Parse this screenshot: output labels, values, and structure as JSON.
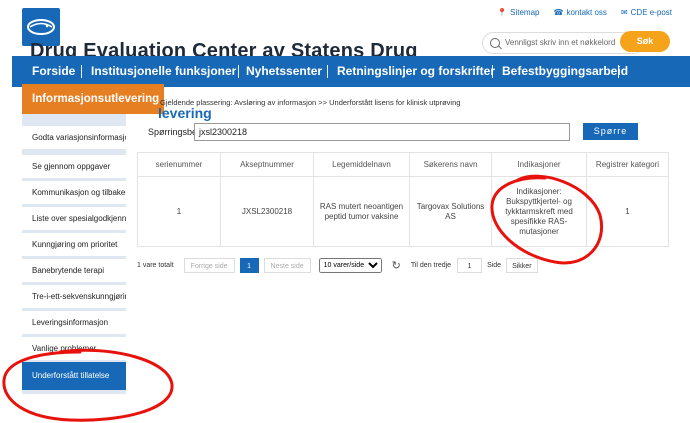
{
  "header": {
    "title": "Drug Evaluation Center av Statens Drug",
    "top_links": [
      {
        "icon": "location-pin-icon",
        "label": "Sitemap"
      },
      {
        "icon": "phone-icon",
        "label": "kontakt oss"
      },
      {
        "icon": "mail-icon",
        "label": "CDE e-post"
      }
    ],
    "search": {
      "placeholder": "Vennligst skriv inn et nøkkelord",
      "button_label": "Søk"
    },
    "accent_color": "#1769b8",
    "orange_color": "#f5a31a"
  },
  "nav": {
    "items": [
      "Forside",
      "Institusjonelle funksjoner",
      "Nyhetssenter",
      "Retningslinjer og forskrifter",
      "Befestbyggingsarbeid"
    ],
    "active_tab": "Informasjonsutlevering"
  },
  "sidebar": {
    "items": [
      "Godta variasjonsinformasjon",
      "Se gjennom oppgaver",
      "Kommunikasjon og tilbakemelding",
      "Liste over spesialgodkjenning",
      "Kunngjøring om prioritet",
      "Banebrytende terapi",
      "Tre-i-ett-sekvenskunngjøring",
      "Leveringsinformasjon",
      "Vanlige problemer",
      "Underforstått tillatelse"
    ],
    "active_index": 9
  },
  "main": {
    "breadcrumb": "Gjeldende plassering: Avsløring av informasjon >> Underforstått lisens for klinisk utprøving",
    "section_title": "levering",
    "query": {
      "label": "Spørringsbe",
      "value": "jxsl2300218",
      "button_label": "Spørre"
    },
    "table": {
      "headers": [
        "serienummer",
        "Akseptnummer",
        "Legemiddelnavn",
        "Søkerens navn",
        "Indikasjoner",
        "Registrer kategori"
      ],
      "rows": [
        [
          "1",
          "JXSL2300218",
          "RAS mutert neoantigen peptid tumor vaksine",
          "Targovax Solutions AS",
          "Indikasjoner: Bukspyttkjertel- og tykktarmskreft med spesifikke RAS-mutasjoner",
          "1"
        ]
      ]
    },
    "pagination": {
      "total": "1 vare totalt",
      "prev": "Forrige side",
      "current": "1",
      "next": "Neste side",
      "per_page": "10 varer/side",
      "goto_label": "Til den tredje",
      "goto_value": "1",
      "page_unit": "Side",
      "confirm": "Sikker"
    }
  }
}
